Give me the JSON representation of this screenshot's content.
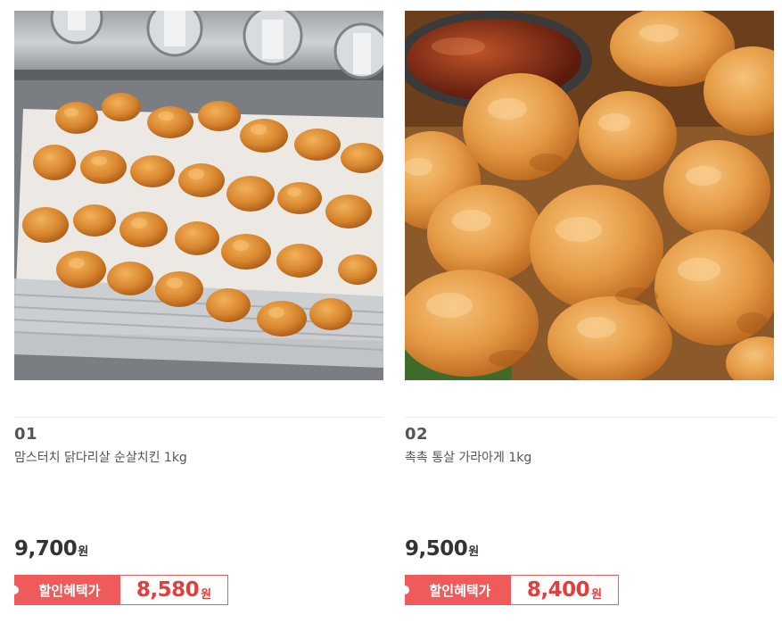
{
  "products": [
    {
      "number": "01",
      "name": "맘스터치 닭다리살 순살치킨 1kg",
      "price": "9,700",
      "price_unit": "원",
      "sale_label": "할인혜택가",
      "sale_price": "8,580",
      "sale_unit": "원",
      "image": "fried-chicken-in-air-fryer-basket"
    },
    {
      "number": "02",
      "name": "촉촉 통살 가라아게 1kg",
      "price": "9,500",
      "price_unit": "원",
      "sale_label": "할인혜택가",
      "sale_price": "8,400",
      "sale_unit": "원",
      "image": "karaage-pile-with-dipping-sauce"
    }
  ],
  "colors": {
    "accent": "#ef5b5b",
    "sale_text": "#e83c3c"
  }
}
